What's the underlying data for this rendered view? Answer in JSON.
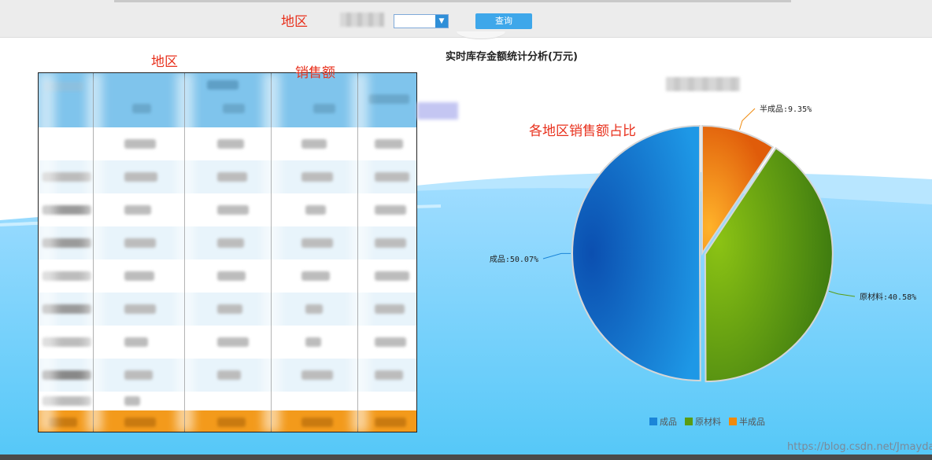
{
  "toolbar": {
    "region_label": "地区",
    "query_label": "查询",
    "select_value": ""
  },
  "table": {
    "header_region": "地区",
    "header_sales": "销售额",
    "row_count": 10
  },
  "chart": {
    "title": "实时库存金额统计分析(万元)",
    "annotation": "各地区销售额占比"
  },
  "chart_data": {
    "type": "pie",
    "title": "实时库存金额统计分析(万元)",
    "slices": [
      {
        "name": "成品",
        "value": 50.07,
        "label": "成品:50.07%",
        "color": "#1b85d8"
      },
      {
        "name": "原材料",
        "value": 40.58,
        "label": "原材料:40.58%",
        "color": "#5a9c12"
      },
      {
        "name": "半成品",
        "value": 9.35,
        "label": "半成品:9.35%",
        "color": "#f08a0c"
      }
    ],
    "legend": [
      "成品",
      "原材料",
      "半成品"
    ],
    "legend_position": "bottom"
  },
  "colors": {
    "accent": "#3ea7ea",
    "annotation_red": "#e8301c",
    "table_header": "#7fc4ec",
    "table_footer": "#f39a1b",
    "sky": "#66cfff"
  },
  "watermark": "https://blog.csdn.net/Jmayday"
}
